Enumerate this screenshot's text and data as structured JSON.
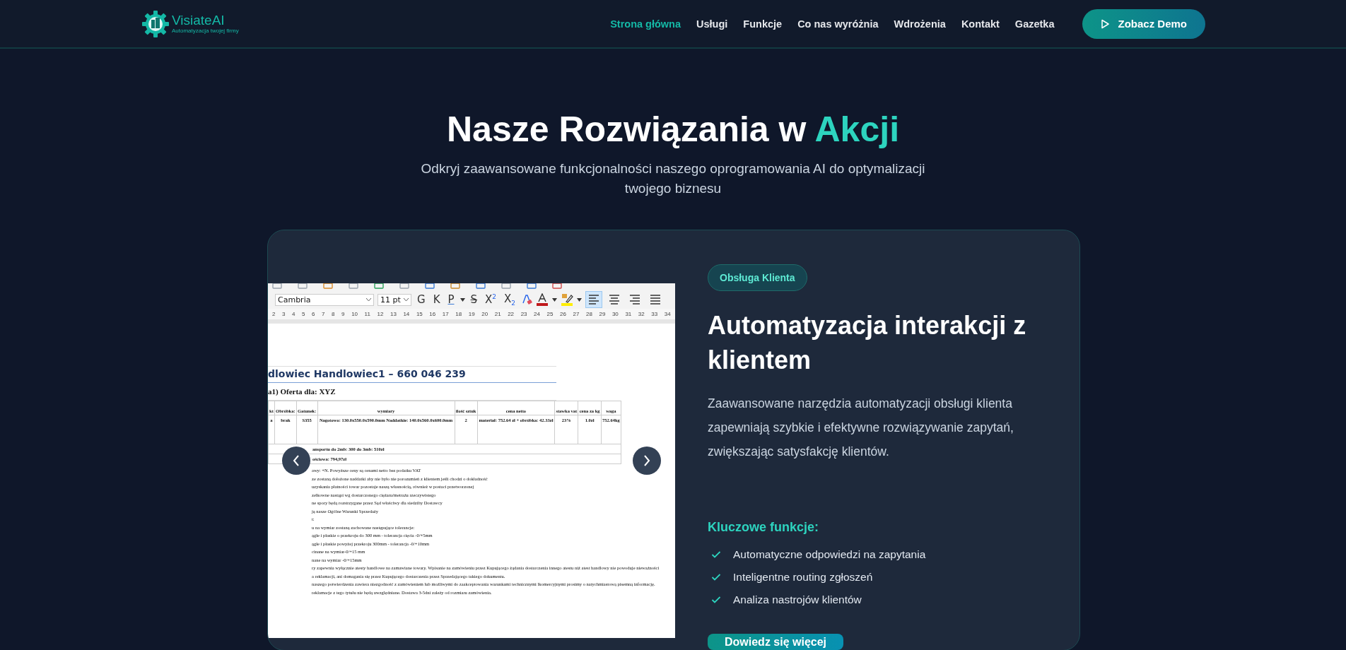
{
  "header": {
    "logo": {
      "name": "VisiateAI",
      "tagline": "Automatyzacja twojej firmy"
    },
    "nav": [
      {
        "label": "Strona główna",
        "selected": true
      },
      {
        "label": "Usługi",
        "selected": false
      },
      {
        "label": "Funkcje",
        "selected": false
      },
      {
        "label": "Co nas wyróżnia",
        "selected": false
      },
      {
        "label": "Wdrożenia",
        "selected": false
      },
      {
        "label": "Kontakt",
        "selected": false
      },
      {
        "label": "Gazetka",
        "selected": false
      }
    ],
    "demo_button": "Zobacz Demo"
  },
  "hero": {
    "title": "Nasze Rozwiązania w",
    "title_accent": "Akcji",
    "subtitle": "Odkryj zaawansowane funkcjonalności naszego oprogramowania AI do optymalizacji twojego biznesu"
  },
  "showcase": {
    "slide": {
      "font_field": "Cambria",
      "size_field": "11 pt",
      "format_buttons": [
        {
          "kind": "text",
          "label": "G"
        },
        {
          "kind": "text",
          "label": "K"
        },
        {
          "kind": "underline",
          "label": "P"
        },
        {
          "kind": "strike",
          "label": "S"
        },
        {
          "kind": "text",
          "label": "X$^{2}$"
        },
        {
          "kind": "text",
          "label": "X$_{2}$"
        },
        {
          "kind": "clear"
        },
        {
          "kind": "font-color",
          "color": "#c0181b"
        },
        {
          "kind": "highlight",
          "color": "#ffee00"
        }
      ],
      "align_buttons": [
        {
          "selected": true
        },
        {
          "selected": false
        },
        {
          "selected": false
        },
        {
          "selected": false
        }
      ],
      "ruler": [
        "2",
        "3",
        "4",
        "5",
        "6",
        "7",
        "8",
        "9",
        "10",
        "11",
        "12",
        "13",
        "14",
        "15",
        "16",
        "17",
        "18",
        "19",
        "20",
        "21",
        "22",
        "23",
        "24",
        "25",
        "26",
        "27",
        "28",
        "29",
        "30",
        "31",
        "32",
        "33",
        "34"
      ],
      "doc_heading": "dlowiec Handlowiec1 – 660 046 239",
      "doc_subheading": "a1) Oferta dla: XYZ",
      "table": {
        "columns": [
          "kt",
          "Obróbka:",
          "Gatunek:",
          "wymiary",
          "ilość sztuk",
          "cena netto",
          "stawka vat",
          "cena za kg",
          "waga"
        ],
        "rows": [
          [
            "a",
            "brak",
            "S355",
            "Nagotowo: 130.0x550.0x590.0mm Naddatkie: 140.0x560.0x600.0mm",
            "2",
            "materiał: 752.64 zł + obróbka: 42.33zł",
            "23%",
            "1.0zł",
            "752.64kg"
          ]
        ],
        "footer_rows": [
          "ansportu do 2mb: 300 do 3mb: 510zł",
          "ościowa: 794,97zł"
        ]
      },
      "doc_lines": [
        "awy: +N. Powyższe ceny są cenami netto bez podatku VAT",
        "ze zostaną dołożone naddatki aby nie było nie porozumień z klientem jeśli chodzi o dokładność",
        "uzyskania płatności towar pozostaje naszą własnością, również w postaci przetworzonej",
        "zelkowne nastąpi wg dostarczonego ciężaru/metrażu rzeczywistego",
        "ne spory będą rozstrzygane przez Sąd właściwy dla siedziby Dostawcy",
        "ją nasze Ogólne Warunki Sprzedaży",
        "t:",
        "u na wymiar zostaną zachowane następujące tolerancje:",
        "ągłe i płaskie o przekroju do 300 mm - tolerancja cięcia -0/+5mm",
        "ągłe i płaskie powyżej przekroju 300mm - tolerancja -0/+10mm",
        "cinane na wymiar-0/+15 mm",
        "nane na wymiar -0/+15mm",
        "ry zapewnia wyłącznie atesty handlowe na zamawiane towary. Wpisanie na zamówieniu przez Kupującego żądania dostarczenia innego atestu niż atest handlowy nie powoduje nieważności",
        "a reklamacji, ani domagania się przez Kupującego dostarczenia przez Sprzedającego takiego dokumentu.",
        "naszego potwierdzenia zawiera niezgodność z zamówieniem lub możliwymi do zaakceptowania warunkami technicznymi lkomercyjnymi prosimy o natychmiastową pisemną informację.",
        "reklamacje z tego tytułu nie będą uwzględniane. Dostawa 3-5dni zależy od rozmiaru zamówienia."
      ]
    },
    "badge": "Obsługa Klienta",
    "title": "Automatyzacja interakcji z klientem",
    "description": "Zaawansowane narzędzia automatyzacji obsługi klienta zapewniają szybkie i efektywne rozwiązywanie zapytań, zwiększając satysfakcję klientów.",
    "features_heading": "Kluczowe funkcje:",
    "features": [
      "Automatyczne odpowiedzi na zapytania",
      "Inteligentne routing zgłoszeń",
      "Analiza nastrojów klientów"
    ],
    "button": "Dowiedz się więcej"
  }
}
